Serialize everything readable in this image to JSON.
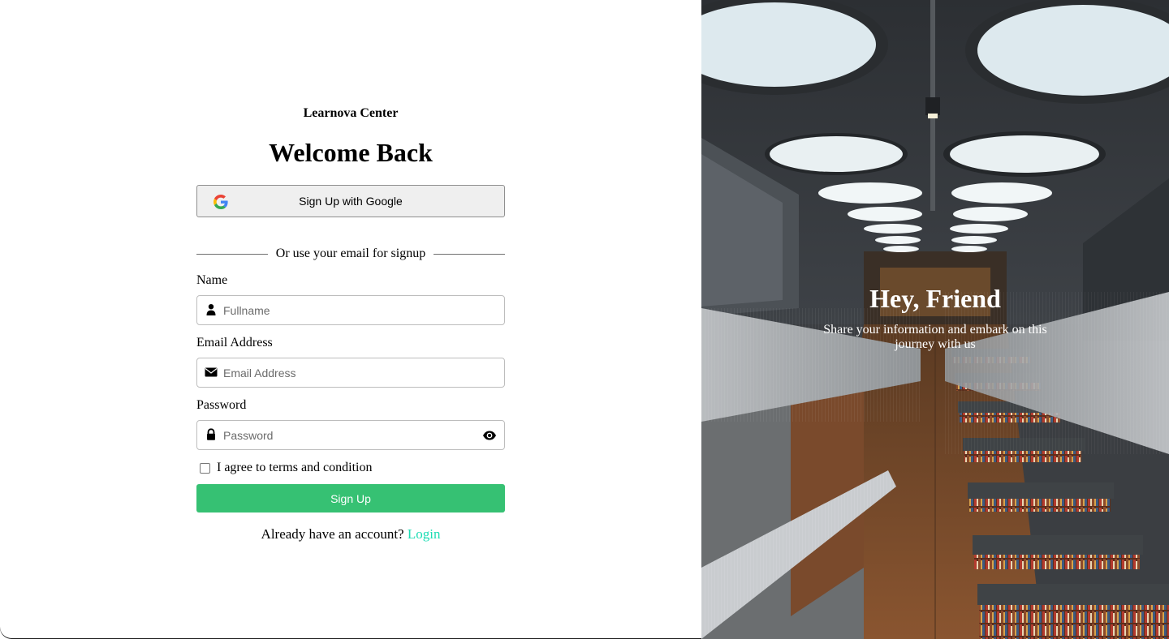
{
  "brand": "Learnova Center",
  "title": "Welcome Back",
  "google_button": "Sign Up with Google",
  "divider_text": "Or use your email for signup",
  "fields": {
    "name": {
      "label": "Name",
      "placeholder": "Fullname",
      "icon": "user-icon"
    },
    "email": {
      "label": "Email Address",
      "placeholder": "Email Address",
      "icon": "envelope-icon"
    },
    "password": {
      "label": "Password",
      "placeholder": "Password",
      "icon": "lock-icon",
      "toggle_icon": "eye-icon"
    }
  },
  "agree_text": "I agree to terms and condition",
  "submit_label": "Sign Up",
  "login_prompt": "Already have an account?",
  "login_link": "Login",
  "hero": {
    "heading": "Hey, Friend",
    "subtext": "Share your information and embark on this journey with us"
  },
  "colors": {
    "primary": "#36c173",
    "link": "#1bdcb3"
  }
}
